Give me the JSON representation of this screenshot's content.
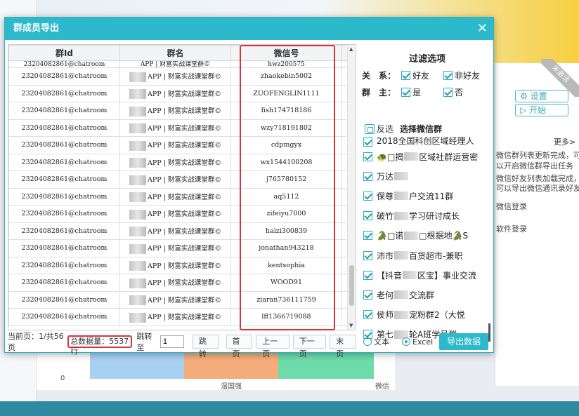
{
  "dialog": {
    "title": "群成员导出",
    "close_icon": "✕"
  },
  "table": {
    "headers": [
      "群Id",
      "群名",
      "微信号"
    ],
    "partial_row": {
      "id": "23204082861@chatroom",
      "name": "APP | 财富实战课堂群©",
      "wxid": "hwz200575"
    },
    "rows": [
      {
        "id": "23204082861@chatroom",
        "name": "APP | 财富实战课堂群©",
        "wxid": "zhaokebin5002"
      },
      {
        "id": "23204082861@chatroom",
        "name": "APP | 财富实战课堂群©",
        "wxid": "ZUOFENGLIN1111"
      },
      {
        "id": "23204082861@chatroom",
        "name": "APP | 财富实战课堂群©",
        "wxid": "fish174718186"
      },
      {
        "id": "23204082861@chatroom",
        "name": "APP | 财富实战课堂群©",
        "wxid": "wzy718191802"
      },
      {
        "id": "23204082861@chatroom",
        "name": "APP | 财富实战课堂群©",
        "wxid": "cdpmgyx"
      },
      {
        "id": "23204082861@chatroom",
        "name": "APP | 财富实战课堂群©",
        "wxid": "wx1544100208"
      },
      {
        "id": "23204082861@chatroom",
        "name": "APP | 财富实战课堂群©",
        "wxid": "j765780152"
      },
      {
        "id": "23204082861@chatroom",
        "name": "APP | 财富实战课堂群©",
        "wxid": "aq5112"
      },
      {
        "id": "23204082861@chatroom",
        "name": "APP | 财富实战课堂群©",
        "wxid": "zifeiyu7000"
      },
      {
        "id": "23204082861@chatroom",
        "name": "APP | 财富实战课堂群©",
        "wxid": "haizi300839"
      },
      {
        "id": "23204082861@chatroom",
        "name": "APP | 财富实战课堂群©",
        "wxid": "jonathan943218"
      },
      {
        "id": "23204082861@chatroom",
        "name": "APP | 财富实战课堂群©",
        "wxid": "kentsophia"
      },
      {
        "id": "23204082861@chatroom",
        "name": "APP | 财富实战课堂群©",
        "wxid": "WOOD91"
      },
      {
        "id": "23204082861@chatroom",
        "name": "APP | 财富实战课堂群©",
        "wxid": "ziaran736111759"
      },
      {
        "id": "23204082861@chatroom",
        "name": "APP | 财富实战课堂群©",
        "wxid": "lff1366719088"
      }
    ]
  },
  "pager": {
    "current": "当前页：1/共56页",
    "total": "总数据量：5537行",
    "jump_to": "跳转至",
    "jump_value": "1",
    "jump_btn": "跳转",
    "first": "首页",
    "prev": "上一页",
    "next": "下一页",
    "last": "末页"
  },
  "filter": {
    "title": "过滤选项",
    "relation_label": "关　系：",
    "friend": "好友",
    "non_friend": "非好友",
    "owner_label": "群　主：",
    "yes": "是",
    "no": "否",
    "reverse": "反选",
    "select_groups": "选择微信群",
    "groups": [
      {
        "pre": "",
        "post": "2018全国科创区域经理人"
      },
      {
        "pre": "🐢□揭",
        "post": "区域社群运营密"
      },
      {
        "pre": "万达",
        "post": ""
      },
      {
        "pre": "保尊",
        "post": "户交流11群"
      },
      {
        "pre": "破竹",
        "post": "学习研讨成长"
      },
      {
        "pre": "🐊□诺",
        "post": "□根据地🐊S"
      },
      {
        "pre": "沛市",
        "post": "百货超市-兼职"
      },
      {
        "pre": "【抖音",
        "post": "区宝】事业交流"
      },
      {
        "pre": "老何",
        "post": "交流群"
      },
      {
        "pre": "侯师",
        "post": "宠粉群2（大悦"
      },
      {
        "pre": "第七",
        "post": "轮A班学员群"
      }
    ],
    "text_option": "文本",
    "excel_option": "Excel",
    "export_btn": "导出数据"
  },
  "background": {
    "ribbon": "未激活",
    "settings_btn": "设置",
    "start_btn": "开始",
    "more": "更多>",
    "notice1": "微信群列表更新完成，可",
    "notice2": "以开启微信群导出任务",
    "notice3": "微信好友列表加载完成，",
    "notice4": "可以导出微信通讯录好友",
    "login1": "微信登录",
    "login2": "软件登录",
    "chart_xlabel": "温国强",
    "chart_xlabel2": "微信",
    "chart_zero": "0"
  },
  "colors": {
    "accent": "#2bb9cb",
    "highlight": "#d9333f"
  }
}
